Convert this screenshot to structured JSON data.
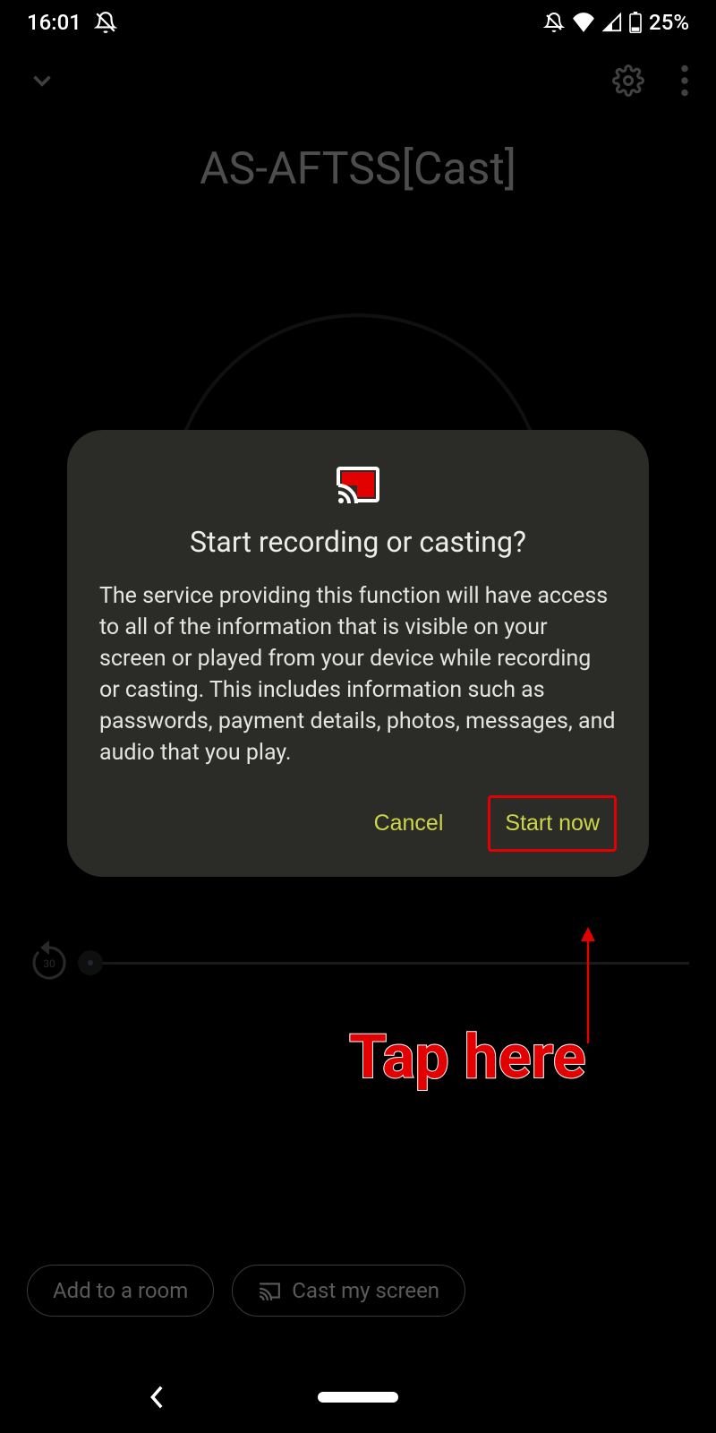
{
  "status": {
    "time": "16:01",
    "battery_text": "25%"
  },
  "page": {
    "device_title": "AS-AFTSS[Cast]",
    "replay_seconds": "30"
  },
  "dialog": {
    "title": "Start recording or casting?",
    "body": "The service providing this function will have access to all of the information that is visible on your screen or played from your device while recording or casting. This includes information such as passwords, payment details, photos, messages, and audio that you play.",
    "cancel_label": "Cancel",
    "confirm_label": "Start now"
  },
  "chips": {
    "add_room": "Add to a room",
    "cast_screen": "Cast my screen"
  },
  "annotation": {
    "text": "Tap here"
  }
}
